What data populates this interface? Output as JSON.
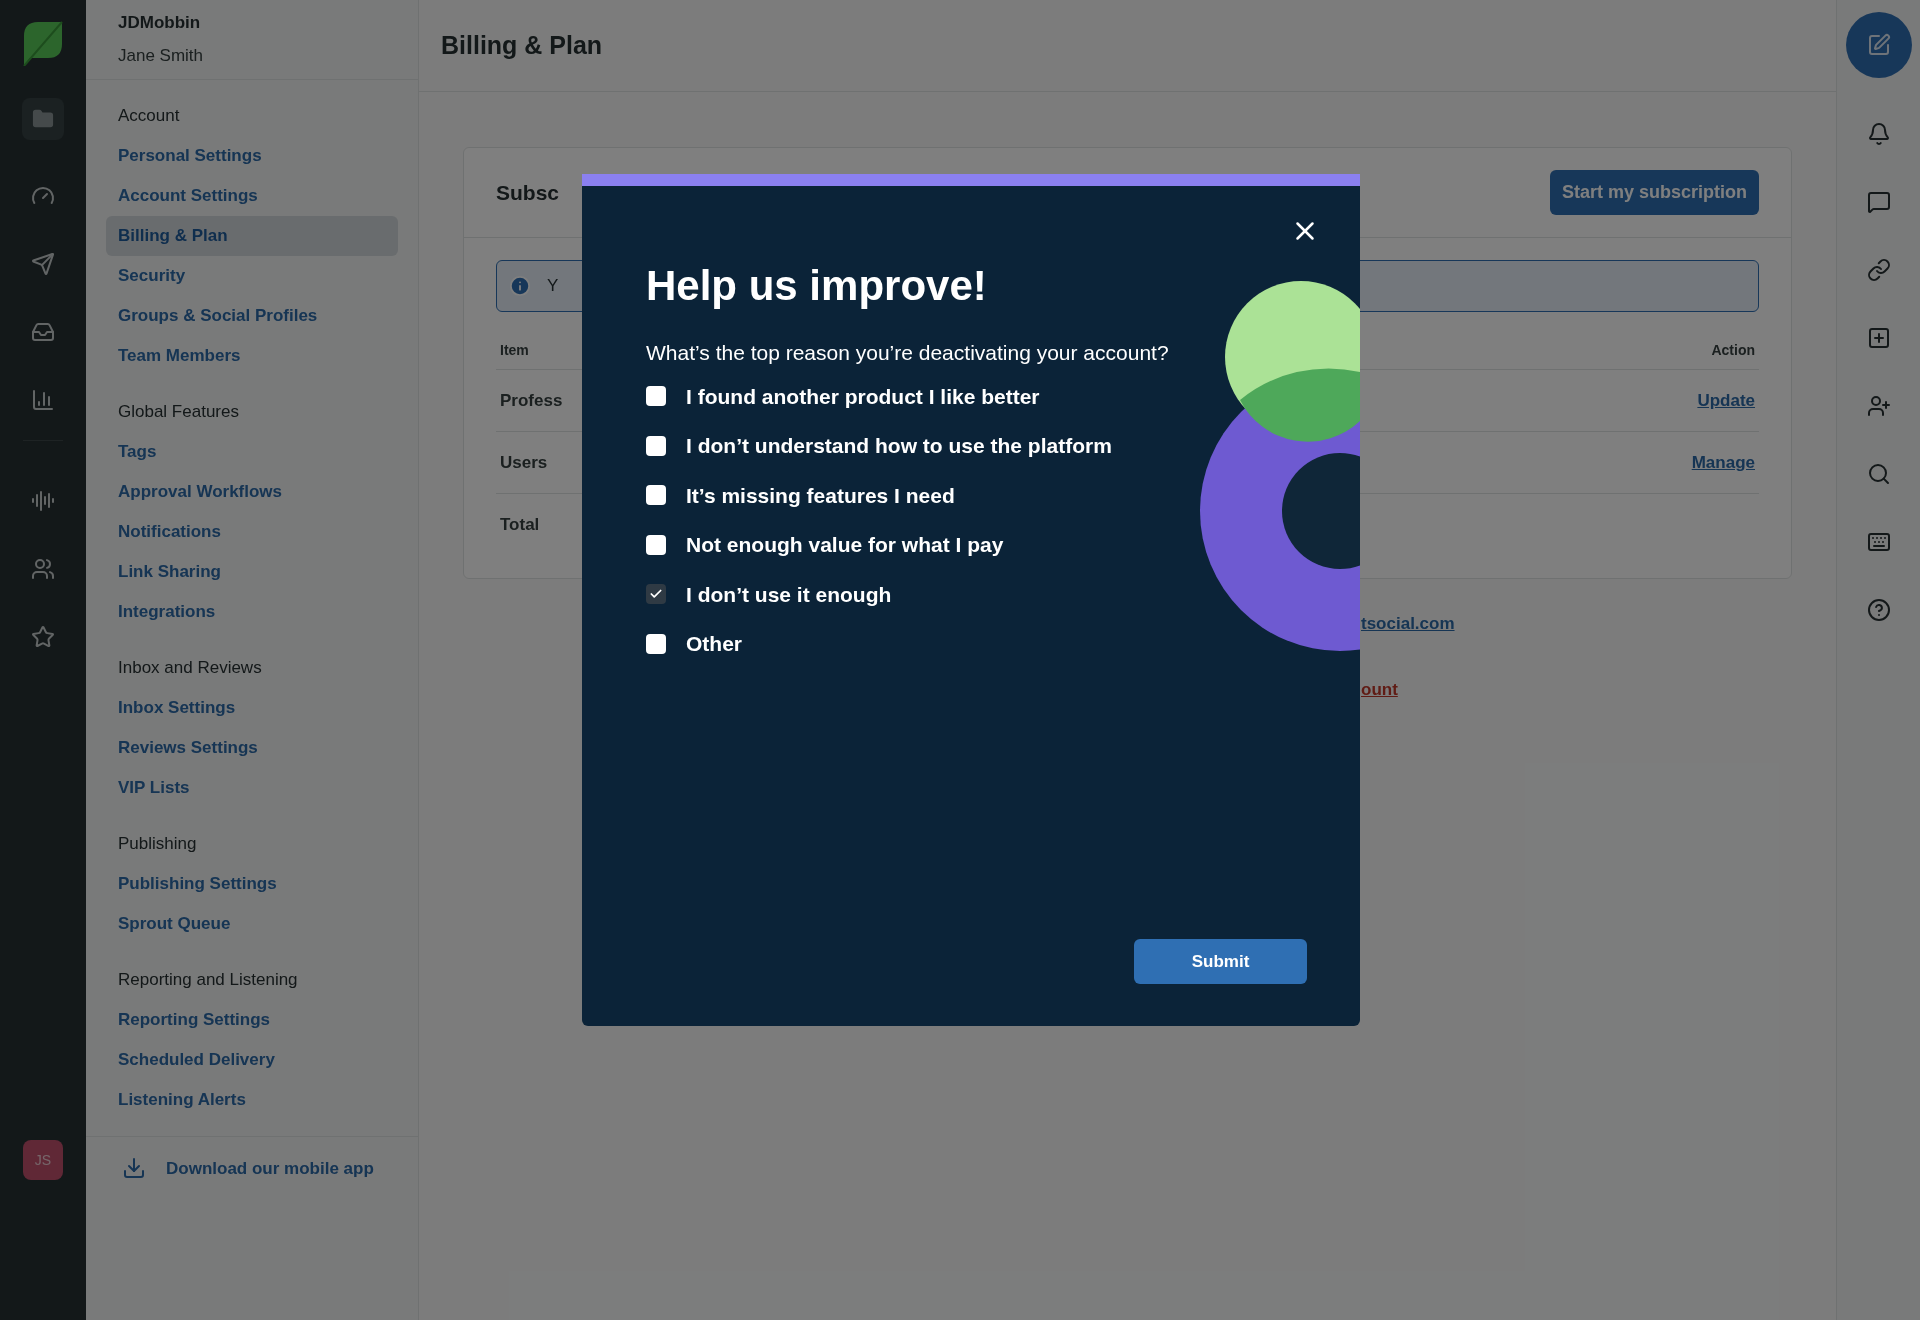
{
  "nav_rail": {
    "avatar": "JS"
  },
  "sidebar": {
    "org": "JDMobbin",
    "user": "Jane Smith",
    "sections": [
      {
        "title": "Account",
        "items": [
          {
            "label": "Personal Settings",
            "selected": false
          },
          {
            "label": "Account Settings",
            "selected": false
          },
          {
            "label": "Billing & Plan",
            "selected": true
          },
          {
            "label": "Security",
            "selected": false
          },
          {
            "label": "Groups & Social Profiles",
            "selected": false
          },
          {
            "label": "Team Members",
            "selected": false
          }
        ]
      },
      {
        "title": "Global Features",
        "items": [
          {
            "label": "Tags",
            "selected": false
          },
          {
            "label": "Approval Workflows",
            "selected": false
          },
          {
            "label": "Notifications",
            "selected": false
          },
          {
            "label": "Link Sharing",
            "selected": false
          },
          {
            "label": "Integrations",
            "selected": false
          }
        ]
      },
      {
        "title": "Inbox and Reviews",
        "items": [
          {
            "label": "Inbox Settings",
            "selected": false
          },
          {
            "label": "Reviews Settings",
            "selected": false
          },
          {
            "label": "VIP Lists",
            "selected": false
          }
        ]
      },
      {
        "title": "Publishing",
        "items": [
          {
            "label": "Publishing Settings",
            "selected": false
          },
          {
            "label": "Sprout Queue",
            "selected": false
          }
        ]
      },
      {
        "title": "Reporting and Listening",
        "items": [
          {
            "label": "Reporting Settings",
            "selected": false
          },
          {
            "label": "Scheduled Delivery",
            "selected": false
          },
          {
            "label": "Listening Alerts",
            "selected": false
          }
        ]
      }
    ],
    "download_link": "Download our mobile app"
  },
  "header": {
    "title": "Billing & Plan"
  },
  "subscription_card": {
    "title": "Subsc",
    "button": "Start my subscription",
    "notice": "Y",
    "columns": [
      "Item",
      "Action"
    ],
    "rows": [
      {
        "item": "Profess",
        "action": "Update"
      },
      {
        "item": "Users",
        "action": "Manage"
      },
      {
        "item": "Total"
      }
    ]
  },
  "links": [
    {
      "text": "tsocial.com",
      "kind": "normal"
    },
    {
      "text": "ount",
      "kind": "danger"
    }
  ],
  "modal": {
    "title": "Help us improve!",
    "question": "What’s the top reason you’re deactivating your account?",
    "options": [
      {
        "label": "I found another product I like better",
        "checked": false
      },
      {
        "label": "I don’t understand how to use the platform",
        "checked": false
      },
      {
        "label": "It’s missing features I need",
        "checked": false
      },
      {
        "label": "Not enough value for what I pay",
        "checked": false
      },
      {
        "label": "I don’t use it enough",
        "checked": true
      },
      {
        "label": "Other",
        "checked": false
      }
    ],
    "submit": "Submit"
  }
}
